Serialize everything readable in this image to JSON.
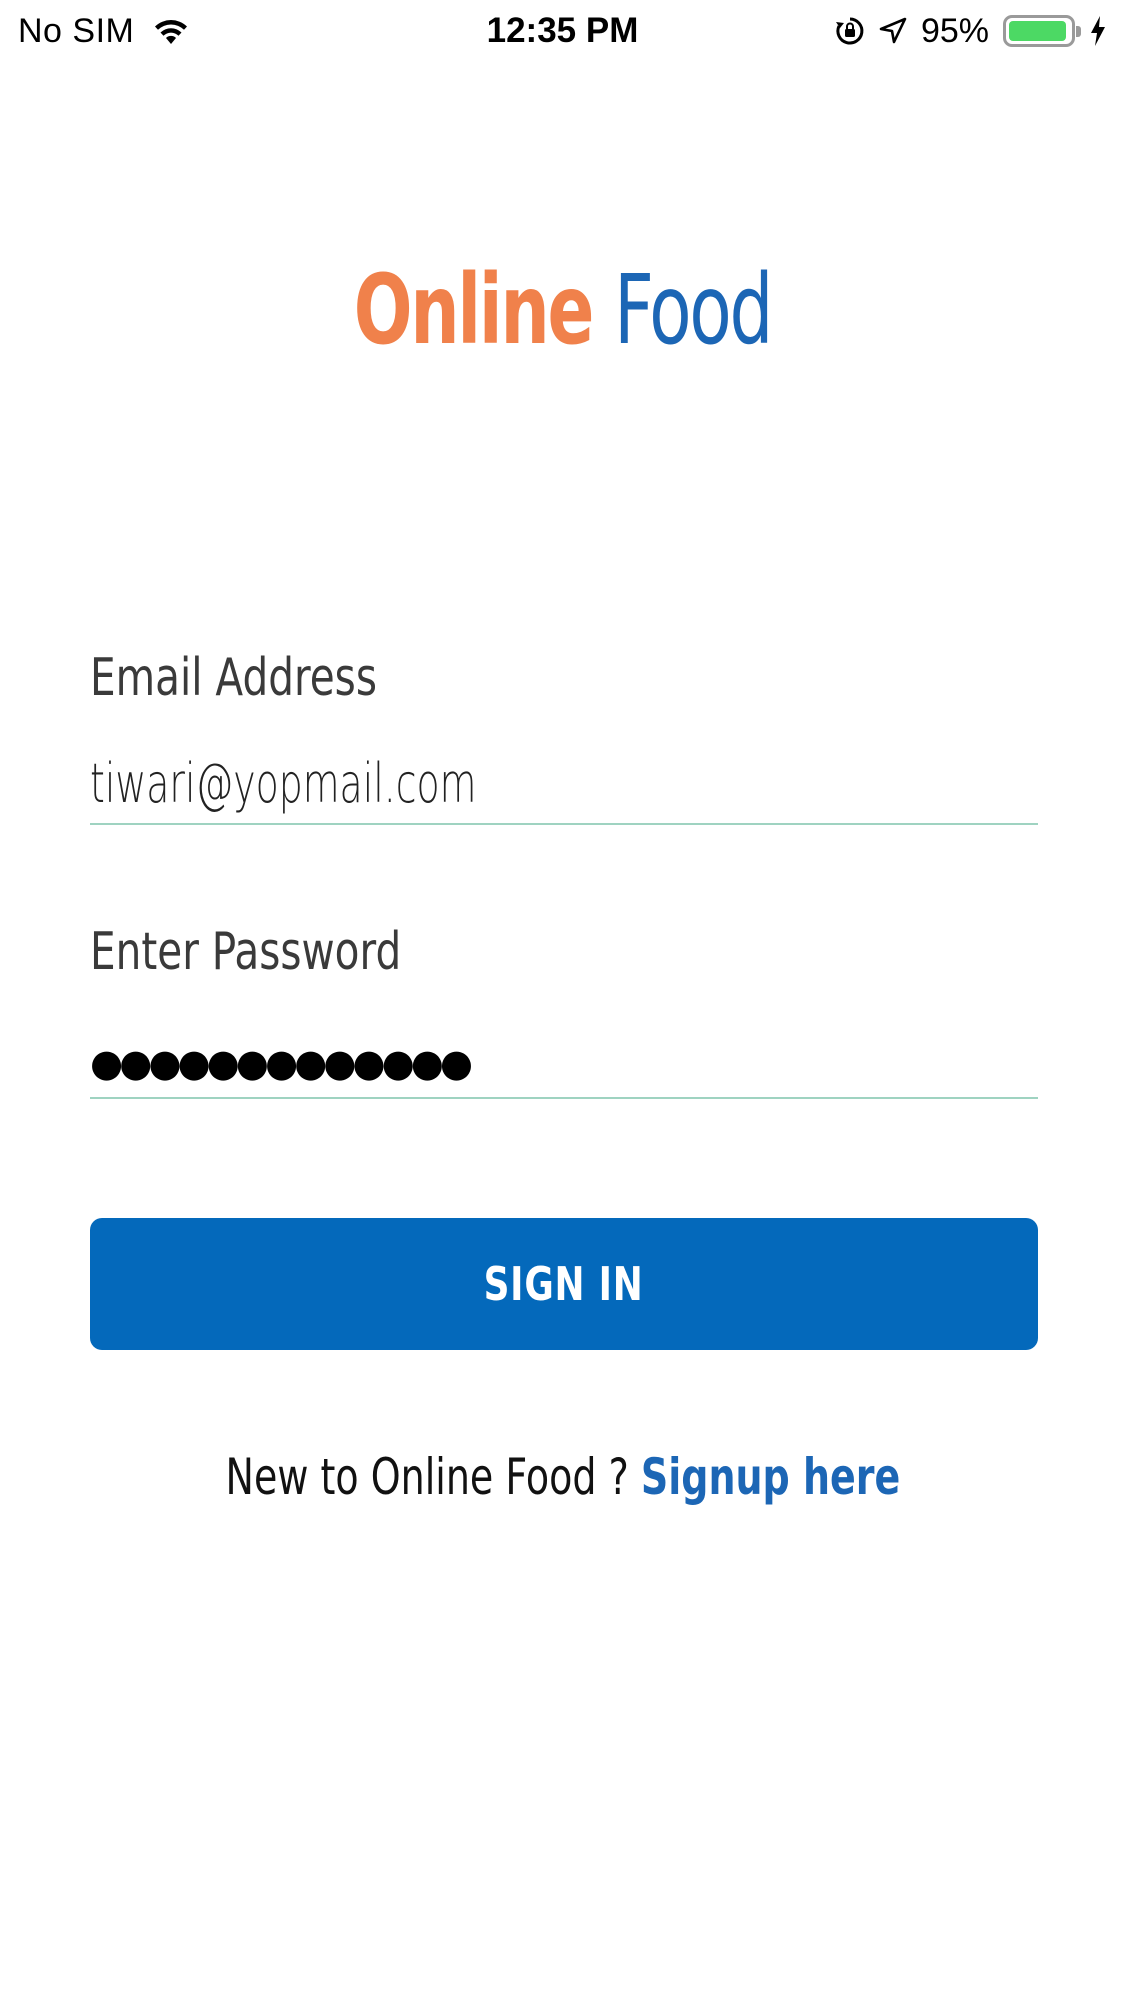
{
  "status_bar": {
    "carrier": "No SIM",
    "time": "12:35 PM",
    "battery_percent": "95%",
    "battery_level": 0.95,
    "icons": [
      "wifi-icon",
      "orientation-lock-icon",
      "location-arrow-icon",
      "battery-icon",
      "charging-bolt-icon"
    ]
  },
  "logo": {
    "word1": "Online",
    "word2": "Food",
    "word1_color": "#f0814b",
    "word2_color": "#1c66b5"
  },
  "form": {
    "email_label": "Email Address",
    "email_value": "tiwari@yopmail.com",
    "password_label": "Enter Password",
    "password_mask": "●●●●●●●●●●●●●",
    "underline_color": "#9fd3c1"
  },
  "signin": {
    "label": "SIGN IN",
    "color": "#0469bb"
  },
  "signup": {
    "prompt": "New to Online Food ?",
    "link": "Signup here"
  }
}
